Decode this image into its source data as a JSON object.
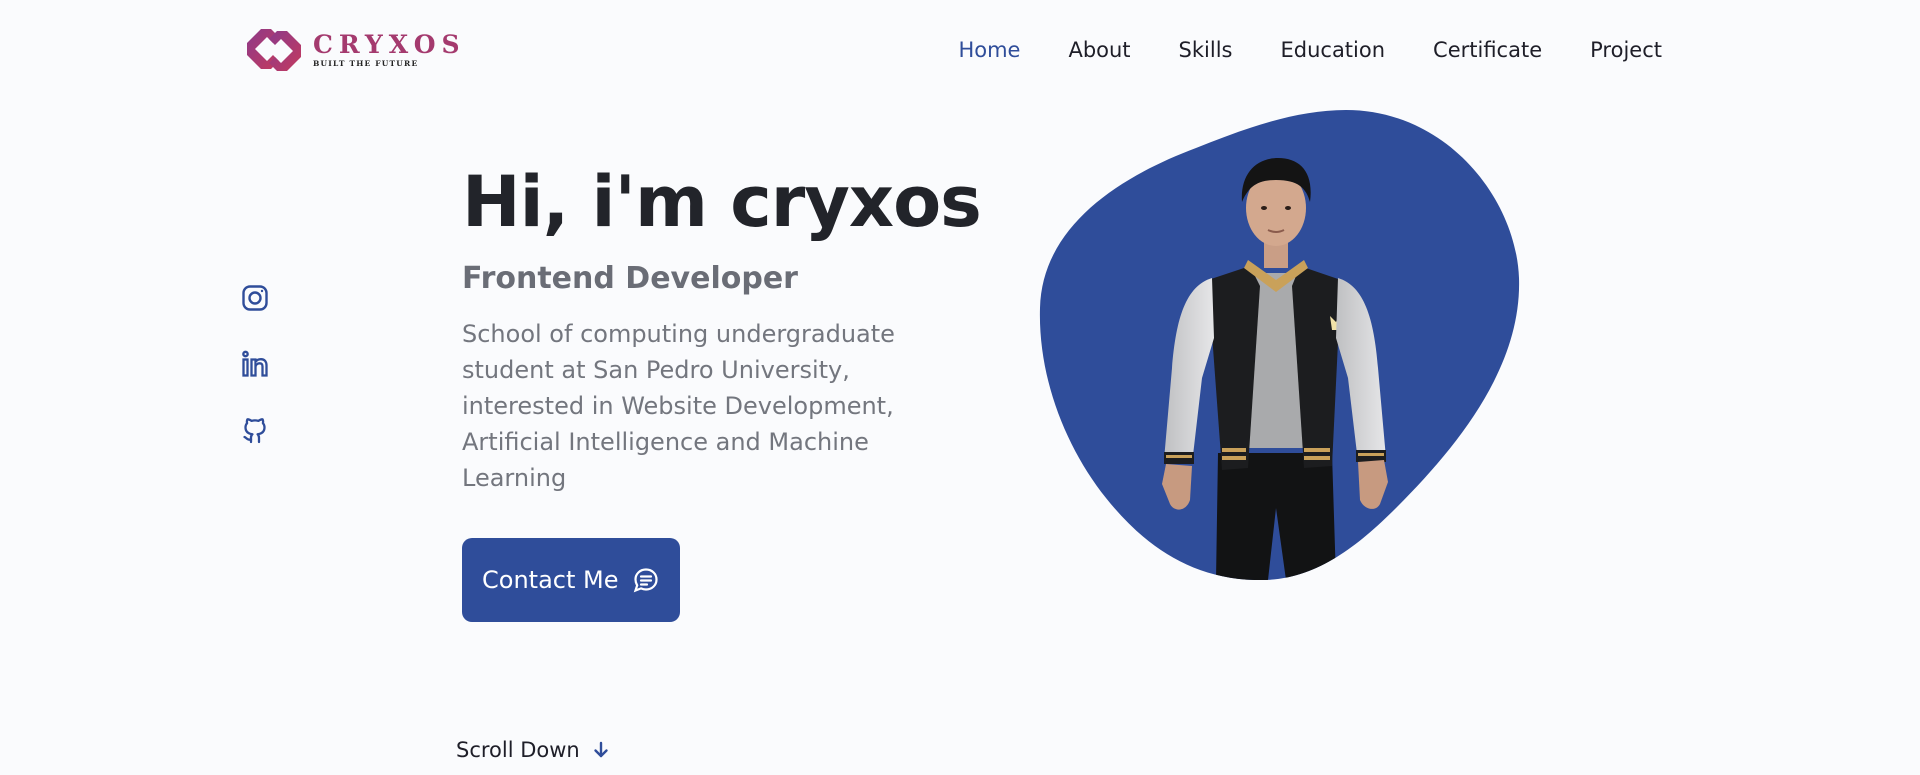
{
  "logo": {
    "name": "CRYXOS",
    "tagline": "BUILT THE FUTURE",
    "icon": "cryxos-logo-icon"
  },
  "nav": {
    "items": [
      {
        "label": "Home",
        "active": true
      },
      {
        "label": "About"
      },
      {
        "label": "Skills"
      },
      {
        "label": "Education"
      },
      {
        "label": "Certificate"
      },
      {
        "label": "Project"
      }
    ]
  },
  "social": {
    "icons": [
      "instagram-icon",
      "linkedin-icon",
      "github-icon"
    ]
  },
  "hero": {
    "title": "Hi, i'm cryxos",
    "subtitle": "Frontend Developer",
    "description": "School of computing undergraduate student at San Pedro University, interested in Website Development, Artificial Intelligence and Machine Learning",
    "contact_label": "Contact Me",
    "contact_icon": "chat-icon"
  },
  "scroll": {
    "label": "Scroll Down",
    "icon": "arrow-down-icon"
  },
  "colors": {
    "accent": "#2f4d9a",
    "brand": "#a43a6e",
    "background": "#fafbfd"
  }
}
